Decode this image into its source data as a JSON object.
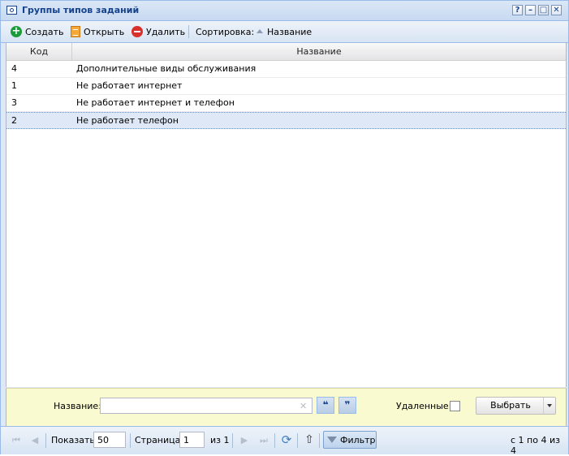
{
  "window": {
    "title": "Группы типов заданий",
    "tools": [
      "?",
      "–",
      "□",
      "✕"
    ]
  },
  "toolbar": {
    "create_label": "Создать",
    "open_label": "Открыть",
    "delete_label": "Удалить",
    "sort_label": "Сортировка:",
    "sort_field": "Название"
  },
  "grid": {
    "columns": [
      "Код",
      "Название"
    ],
    "rows": [
      {
        "code": "4",
        "name": "Дополнительные виды обслуживания"
      },
      {
        "code": "1",
        "name": "Не работает интернет"
      },
      {
        "code": "3",
        "name": "Не работает интернет и телефон"
      },
      {
        "code": "2",
        "name": "Не работает телефон"
      }
    ],
    "selected_index": 3
  },
  "filter": {
    "name_label": "Название:",
    "name_value": "",
    "quote_open": "❝",
    "quote_close": "❞",
    "deleted_label": "Удаленные:",
    "deleted_checked": false,
    "select_label": "Выбрать"
  },
  "pager": {
    "show_label": "Показать",
    "page_size": "50",
    "page_label": "Страница",
    "page_value": "1",
    "of_pages": "из 1",
    "filter_label": "Фильтр",
    "summary": "с 1 по 4 из 4"
  },
  "colors": {
    "title_text": "#15428b",
    "border": "#99bbe8",
    "filter_bg": "#fafad0",
    "selected_row": "#dfe8f6"
  }
}
